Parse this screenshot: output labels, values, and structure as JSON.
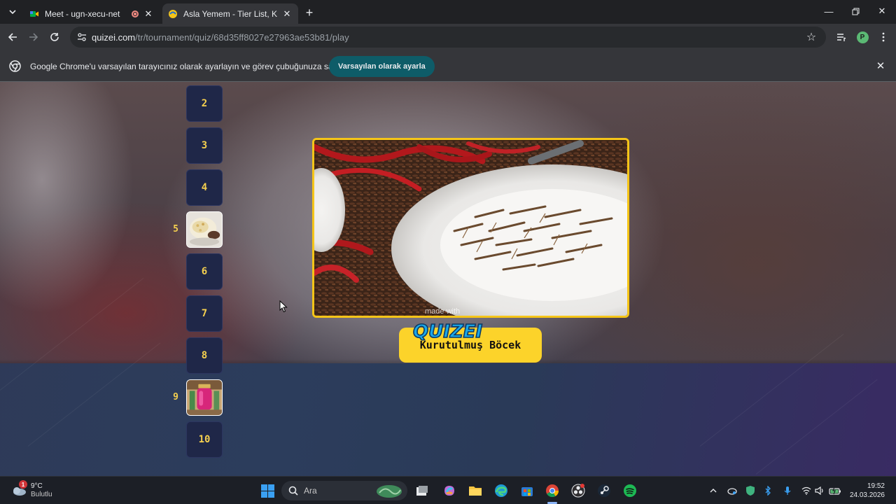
{
  "browser": {
    "tabs": [
      {
        "title": "Meet - ugn-xecu-net",
        "recording": true
      },
      {
        "title": "Asla Yemem - Tier List, Kör Sıral"
      }
    ],
    "url": {
      "host": "quizei.com",
      "path": "/tr/tournament/quiz/68d35ff8027e27963ae53b81/play"
    },
    "profile_initial": "P"
  },
  "infobar": {
    "message": "Google Chrome'u varsayılan tarayıcınız olarak ayarlayın ve görev çubuğunuza sabitleyin",
    "button_label": "Varsayılan olarak ayarla"
  },
  "quiz": {
    "ranks": [
      {
        "number": "2",
        "filled": false
      },
      {
        "number": "3",
        "filled": false
      },
      {
        "number": "4",
        "filled": false
      },
      {
        "number": "5",
        "filled": true,
        "thumb": "rice-dish"
      },
      {
        "number": "6",
        "filled": false
      },
      {
        "number": "7",
        "filled": false
      },
      {
        "number": "8",
        "filled": false
      },
      {
        "number": "9",
        "filled": true,
        "thumb": "pickled-jar"
      },
      {
        "number": "10",
        "filled": false
      }
    ],
    "current_item": {
      "name": "Kurutulmuş Böcek",
      "watermark": "made with"
    },
    "logo_text": "QUIZEI"
  },
  "taskbar": {
    "weather": {
      "temp": "9°C",
      "condition": "Bulutlu",
      "badge": "1"
    },
    "search_placeholder": "Ara",
    "time": "19:52",
    "date": "24.03.2026"
  },
  "colors": {
    "accent_yellow": "#f5c518",
    "pill_yellow": "#fcd32a",
    "slot_bg": "#1f2748",
    "infobar_button": "#0e5c68"
  }
}
